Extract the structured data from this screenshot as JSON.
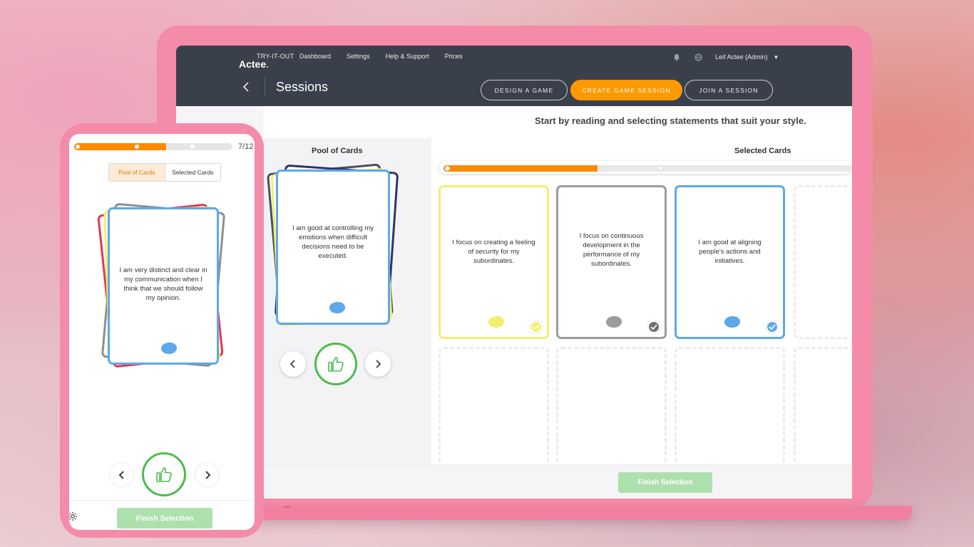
{
  "brand": {
    "tagline": "TRY-IT-OUT",
    "name": "Actee",
    "dot": "."
  },
  "nav": [
    "Dashboard",
    "Settings",
    "Help & Support",
    "Prices"
  ],
  "user": {
    "name": "Leif Actee (Admin)"
  },
  "page": {
    "title": "Sessions"
  },
  "actions": {
    "design": "DESIGN A GAME",
    "create": "CREATE GAME SESSION",
    "join": "JOIN A SESSION"
  },
  "instructions": "Start by reading and selecting statements that suit your style.",
  "pool": {
    "label": "Pool of Cards",
    "top_card": "I am good at controlling my emotions when difficult decisions need to be executed."
  },
  "selected": {
    "label": "Selected Cards",
    "progress_fraction": 0.37,
    "cards": [
      {
        "text": "I focus on creating a feeling of security for my subordinates.",
        "color": "#f2ef6f"
      },
      {
        "text": "I focus on continuous development in the performance of my subordinates.",
        "color": "#9a9c9e"
      },
      {
        "text": "I am good at aligning people's actions and initiatives.",
        "color": "#5da8ea"
      }
    ]
  },
  "finish_label": "Finish Selection",
  "mobile": {
    "count": "7/12",
    "progress_fraction": 0.58,
    "tabs": [
      "Pool of Cards",
      "Selected Cards"
    ],
    "top_card": "I am very distinct and clear in my communication when I think that we should follow my opinion.",
    "finish_label": "Finish Selection"
  },
  "colors": {
    "accent": "#ff9900",
    "like": "#4fba4f",
    "phone_frame": "#f48ba9",
    "topbar": "#3a404b"
  }
}
